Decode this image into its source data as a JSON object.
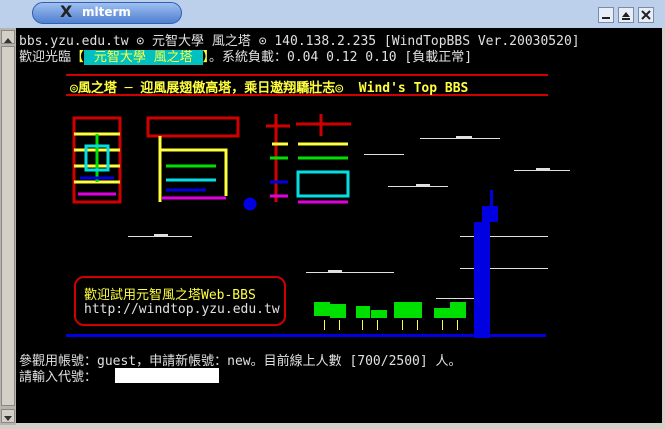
{
  "window": {
    "title": "mlterm",
    "x_logo": "X"
  },
  "terminal": {
    "line1": "bbs.yzu.edu.tw ⊙ 元智大學 風之塔 ⊙ 140.138.2.235 [WindTopBBS Ver.20030520]",
    "line2_prefix": "歡迎光臨",
    "line2_bracket_open": "【",
    "line2_highlight": " 元智大學 風之塔 ",
    "line2_bracket_close": "】",
    "line2_suffix": "。系統負載：0.04 0.12 0.10 [負載正常]",
    "banner": "◎風之塔 ─ 迎風展翅傲高塔，乘日遨翔驕壯志◎  Wind's Top BBS",
    "web_line1": "歡迎試用元智風之塔Web-BBS",
    "web_line2": "http://windtop.yzu.edu.tw",
    "prompt_line": "參觀用帳號：guest，申請新帳號：new。目前線上人數 [700/2500] 人。",
    "login_prompt": "請輸入代號：",
    "login_value": ""
  },
  "colors": {
    "red": "#d00000",
    "yellow": "#ffff40",
    "green": "#00e000",
    "cyan": "#00e0e0",
    "blue": "#0000e0",
    "magenta": "#e000e0"
  }
}
